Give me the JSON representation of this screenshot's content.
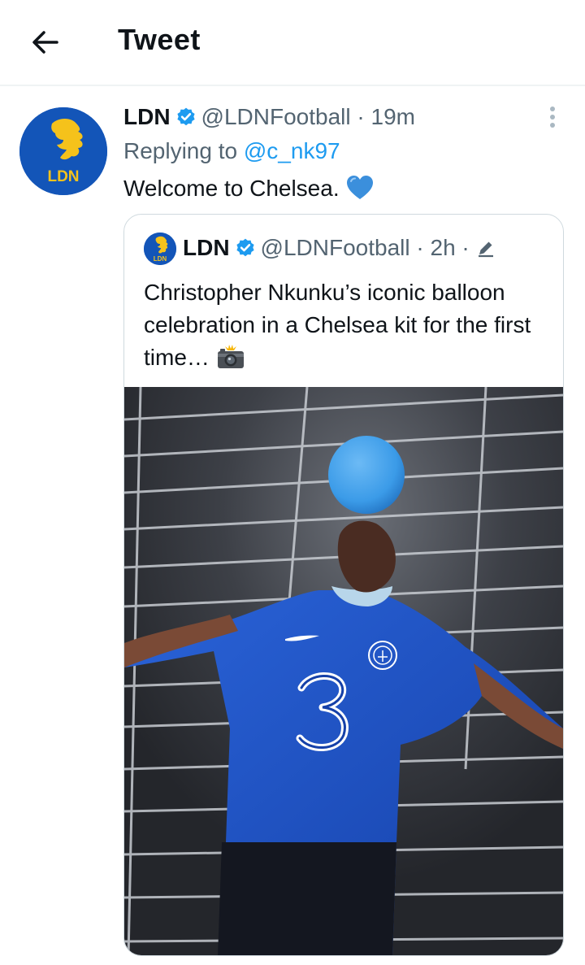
{
  "header": {
    "title": "Tweet",
    "back_icon": "arrow-left-icon"
  },
  "tweet": {
    "author_name": "LDN",
    "author_handle": "@LDNFootball",
    "separator": " · ",
    "time": "19m",
    "replying_prefix": "Replying to ",
    "replying_to": "@c_nk97",
    "text": "Welcome to Chelsea.",
    "avatar_text": "LDN",
    "emoji_icon": "blue-heart-icon",
    "more_icon": "more-vertical-icon"
  },
  "quoted_tweet": {
    "author_name": "LDN",
    "author_handle": "@LDNFootball",
    "separator": " · ",
    "time": "2h",
    "edit_separator": " ·",
    "avatar_text": "LDN",
    "text": "Christopher Nkunku’s iconic balloon celebration in a Chelsea kit for the first time…",
    "emoji_icon": "camera-flash-icon",
    "image": {
      "shirt_sponsor": "3",
      "ball_color": "#3b9be8",
      "shirt_color": "#1a4fc4"
    }
  },
  "colors": {
    "link": "#1d9bf0",
    "verified": "#1d9bf0",
    "brand_blue": "#1355b8",
    "brand_gold": "#f5c21b",
    "secondary_text": "#536471",
    "border": "#cfd9de"
  }
}
